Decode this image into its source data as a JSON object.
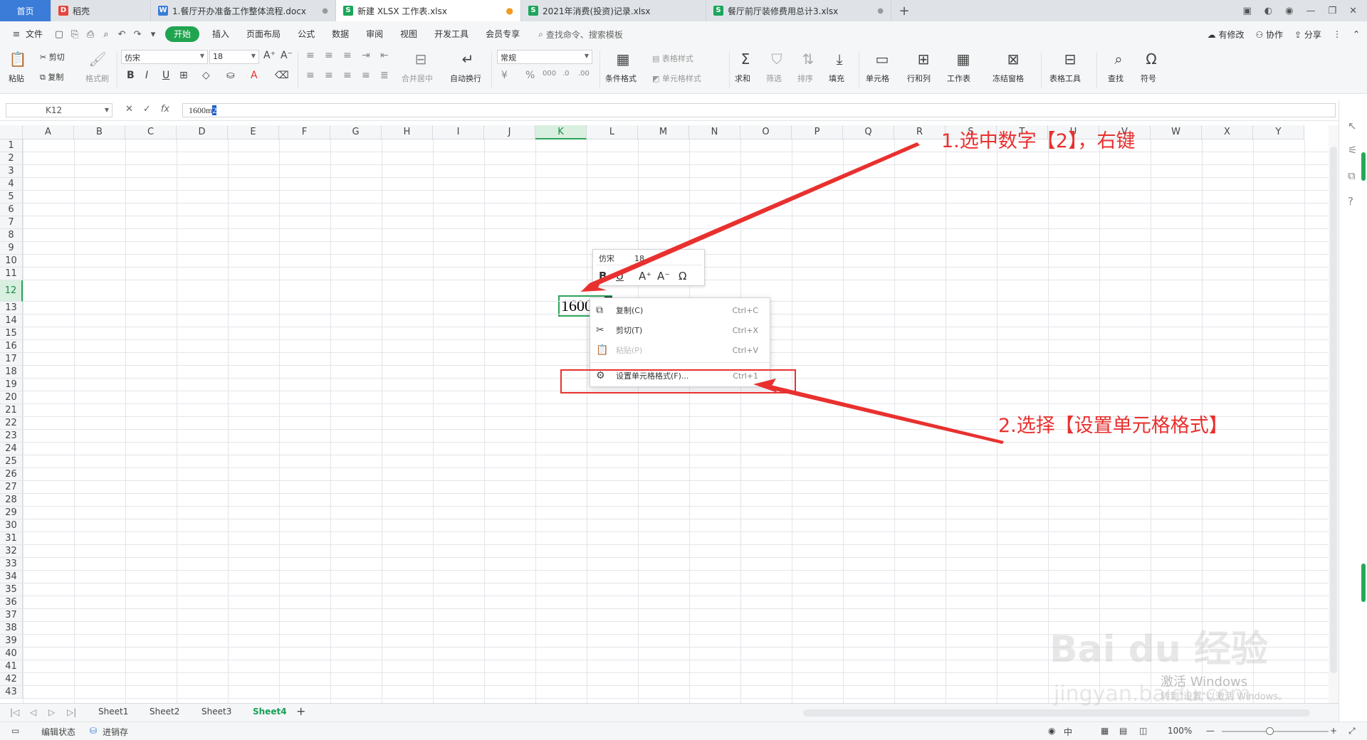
{
  "tabs": {
    "home": "首页",
    "items": [
      {
        "label": "稻壳",
        "icon_color": "#e8453c",
        "icon": "D"
      },
      {
        "label": "1.餐厅开办准备工作整体流程.docx",
        "icon_color": "#3b7cd8",
        "icon": "W"
      },
      {
        "label": "新建 XLSX 工作表.xlsx",
        "icon_color": "#1ba65a",
        "icon": "S"
      },
      {
        "label": "2021年消费(投资)记录.xlsx",
        "icon_color": "#1ba65a",
        "icon": "S"
      },
      {
        "label": "餐厅前厅装修费用总计3.xlsx",
        "icon_color": "#1ba65a",
        "icon": "S"
      }
    ],
    "add": "+"
  },
  "menu": {
    "file": "文件",
    "items": [
      "开始",
      "插入",
      "页面布局",
      "公式",
      "数据",
      "审阅",
      "视图",
      "开发工具",
      "会员专享"
    ],
    "search": "查找命令、搜索模板",
    "right": [
      "有修改",
      "协作",
      "分享"
    ]
  },
  "ribbon": {
    "paste": "粘贴",
    "cut": "剪切",
    "copy": "复制",
    "format_painter": "格式刷",
    "font_name": "仿宋",
    "font_size": "18",
    "merge": "合并居中",
    "wrap": "自动换行",
    "number_format": "常规",
    "cond_format": "条件格式",
    "table_style": "表格样式",
    "cell_style": "单元格样式",
    "sum": "求和",
    "filter": "筛选",
    "sort": "排序",
    "fill": "填充",
    "cell": "单元格",
    "rowcol": "行和列",
    "sheet": "工作表",
    "freeze": "冻结窗格",
    "table_tools": "表格工具",
    "find": "查找",
    "symbol": "符号"
  },
  "formula_bar": {
    "name_box": "K12",
    "formula_prefix": "1600m",
    "formula_selected": "2",
    "fx": "fx"
  },
  "grid": {
    "columns": [
      "A",
      "B",
      "C",
      "D",
      "E",
      "F",
      "G",
      "H",
      "I",
      "J",
      "K",
      "L",
      "M",
      "N",
      "O",
      "P",
      "Q",
      "R",
      "S",
      "T",
      "U",
      "V",
      "W",
      "X",
      "Y"
    ],
    "rows": [
      "1",
      "2",
      "3",
      "4",
      "5",
      "6",
      "7",
      "8",
      "9",
      "10",
      "11",
      "12",
      "13",
      "14",
      "15",
      "16",
      "17",
      "18",
      "19",
      "20",
      "21",
      "22",
      "23",
      "24",
      "25",
      "26",
      "27",
      "28",
      "29",
      "30",
      "31",
      "32",
      "33",
      "34",
      "35",
      "36",
      "37",
      "38",
      "39",
      "40",
      "41",
      "42",
      "43"
    ],
    "selected_column": "K",
    "selected_row": "12",
    "cell_text_prefix": "1600m",
    "cell_text_selected": "2"
  },
  "mini_toolbar": {
    "font": "仿宋",
    "size": "18",
    "bold": "B",
    "underline": "U",
    "grow": "A⁺",
    "shrink": "A⁻",
    "symbol": "Ω"
  },
  "context_menu": {
    "items": [
      {
        "label": "复制(C)",
        "shortcut": "Ctrl+C",
        "icon": "copy-icon",
        "enabled": true
      },
      {
        "label": "剪切(T)",
        "shortcut": "Ctrl+X",
        "icon": "scissors-icon",
        "enabled": true
      },
      {
        "label": "粘贴(P)",
        "shortcut": "Ctrl+V",
        "icon": "paste-icon",
        "enabled": false
      },
      {
        "label": "设置单元格格式(F)...",
        "shortcut": "Ctrl+1",
        "icon": "format-cells-icon",
        "enabled": true
      }
    ]
  },
  "sheets": {
    "items": [
      "Sheet1",
      "Sheet2",
      "Sheet3",
      "Sheet4"
    ],
    "active": "Sheet4",
    "add": "+"
  },
  "status": {
    "edit_state": "编辑状态",
    "inventory": "进销存",
    "lang": "中",
    "zoom": "100%"
  },
  "annotations": {
    "step1": "1.选中数字【2】，右键",
    "step2": "2.选择【设置单元格格式】",
    "color": "#e8312f"
  },
  "watermark": {
    "logo": "Bai du 经验",
    "url": "jingyan.baidu.com",
    "activate_title": "激活 Windows",
    "activate_sub": "转到\"设置\"以激活 Windows。"
  }
}
